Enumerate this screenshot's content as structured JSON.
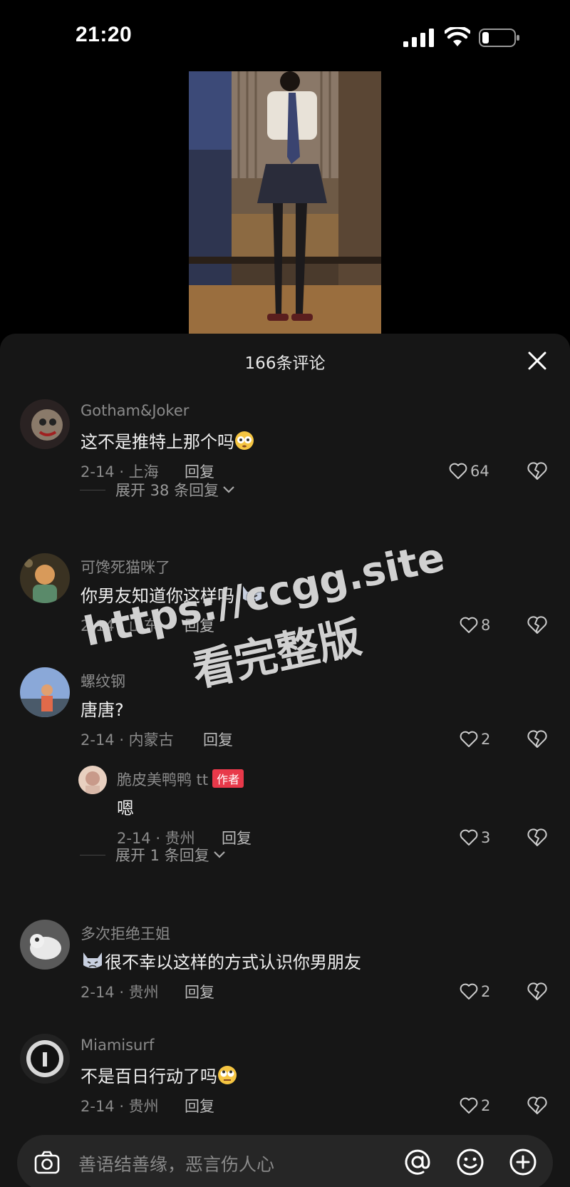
{
  "status": {
    "time": "21:20"
  },
  "sheet": {
    "title": "166条评论"
  },
  "comments": [
    {
      "username": "Gotham&Joker",
      "text": "这不是推特上那个吗",
      "date": "2-14 · 上海",
      "reply": "回复",
      "likes": "64",
      "expand": "展开 38 条回复"
    },
    {
      "username": "可馋死猫咪了",
      "text": "你男友知道你这样吗",
      "date": "2-14 · 山东",
      "reply": "回复",
      "likes": "8"
    },
    {
      "username": "螺纹钢",
      "text": "唐唐?",
      "date": "2-14 · 内蒙古",
      "reply": "回复",
      "likes": "2",
      "sub_reply": {
        "username": "脆皮美鸭鸭 tt",
        "badge": "作者",
        "text": "嗯",
        "date": "2-14 · 贵州",
        "reply": "回复",
        "likes": "3"
      },
      "expand": "展开 1 条回复"
    },
    {
      "username": "多次拒绝王姐",
      "text": "很不幸以这样的方式认识你男朋友",
      "date": "2-14 · 贵州",
      "reply": "回复",
      "likes": "2"
    },
    {
      "username": "Miamisurf",
      "text": "不是百日行动了吗",
      "date": "2-14 · 贵州",
      "reply": "回复",
      "likes": "2"
    }
  ],
  "watermark": {
    "line1": "https://ccgg.site",
    "line2": "看完整版"
  },
  "input": {
    "placeholder": "善语结善缘，恶言伤人心"
  },
  "colors": {
    "sheet_bg": "#161616",
    "author_badge": "#e8394a",
    "muted_text": "#8a8a8a"
  },
  "icons": [
    "signal-icon",
    "wifi-icon",
    "battery-icon",
    "close-icon",
    "heart-icon",
    "broken-heart-icon",
    "chevron-down-icon",
    "camera-icon",
    "at-icon",
    "emoji-icon",
    "plus-icon"
  ]
}
